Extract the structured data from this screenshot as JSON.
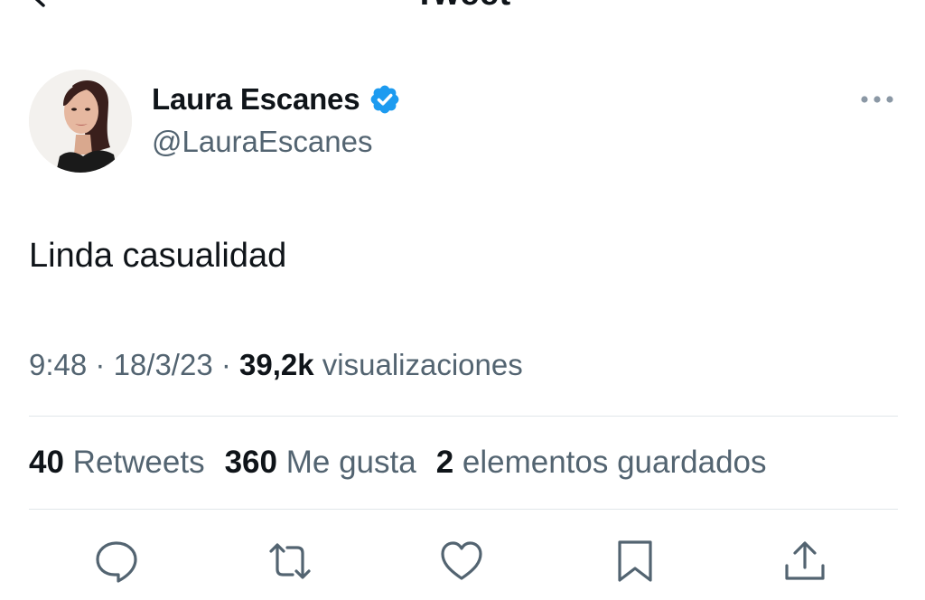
{
  "header": {
    "title": "Tweet"
  },
  "user": {
    "display_name": "Laura Escanes",
    "handle": "@LauraEscanes",
    "verified": true
  },
  "tweet": {
    "text": "Linda casualidad",
    "time": "9:48",
    "date": "18/3/23",
    "views_count": "39,2k",
    "views_label": "visualizaciones"
  },
  "stats": {
    "retweets_count": "40",
    "retweets_label": "Retweets",
    "likes_count": "360",
    "likes_label": "Me gusta",
    "bookmarks_count": "2",
    "bookmarks_label": "elementos guardados"
  },
  "colors": {
    "verified_blue": "#1d9bf0",
    "secondary_text": "#536471",
    "primary_text": "#0f1419"
  },
  "icons": {
    "back": "arrow-left-icon",
    "more": "more-horizontal-icon",
    "reply": "reply-icon",
    "retweet": "retweet-icon",
    "like": "heart-icon",
    "bookmark": "bookmark-icon",
    "share": "share-icon"
  }
}
